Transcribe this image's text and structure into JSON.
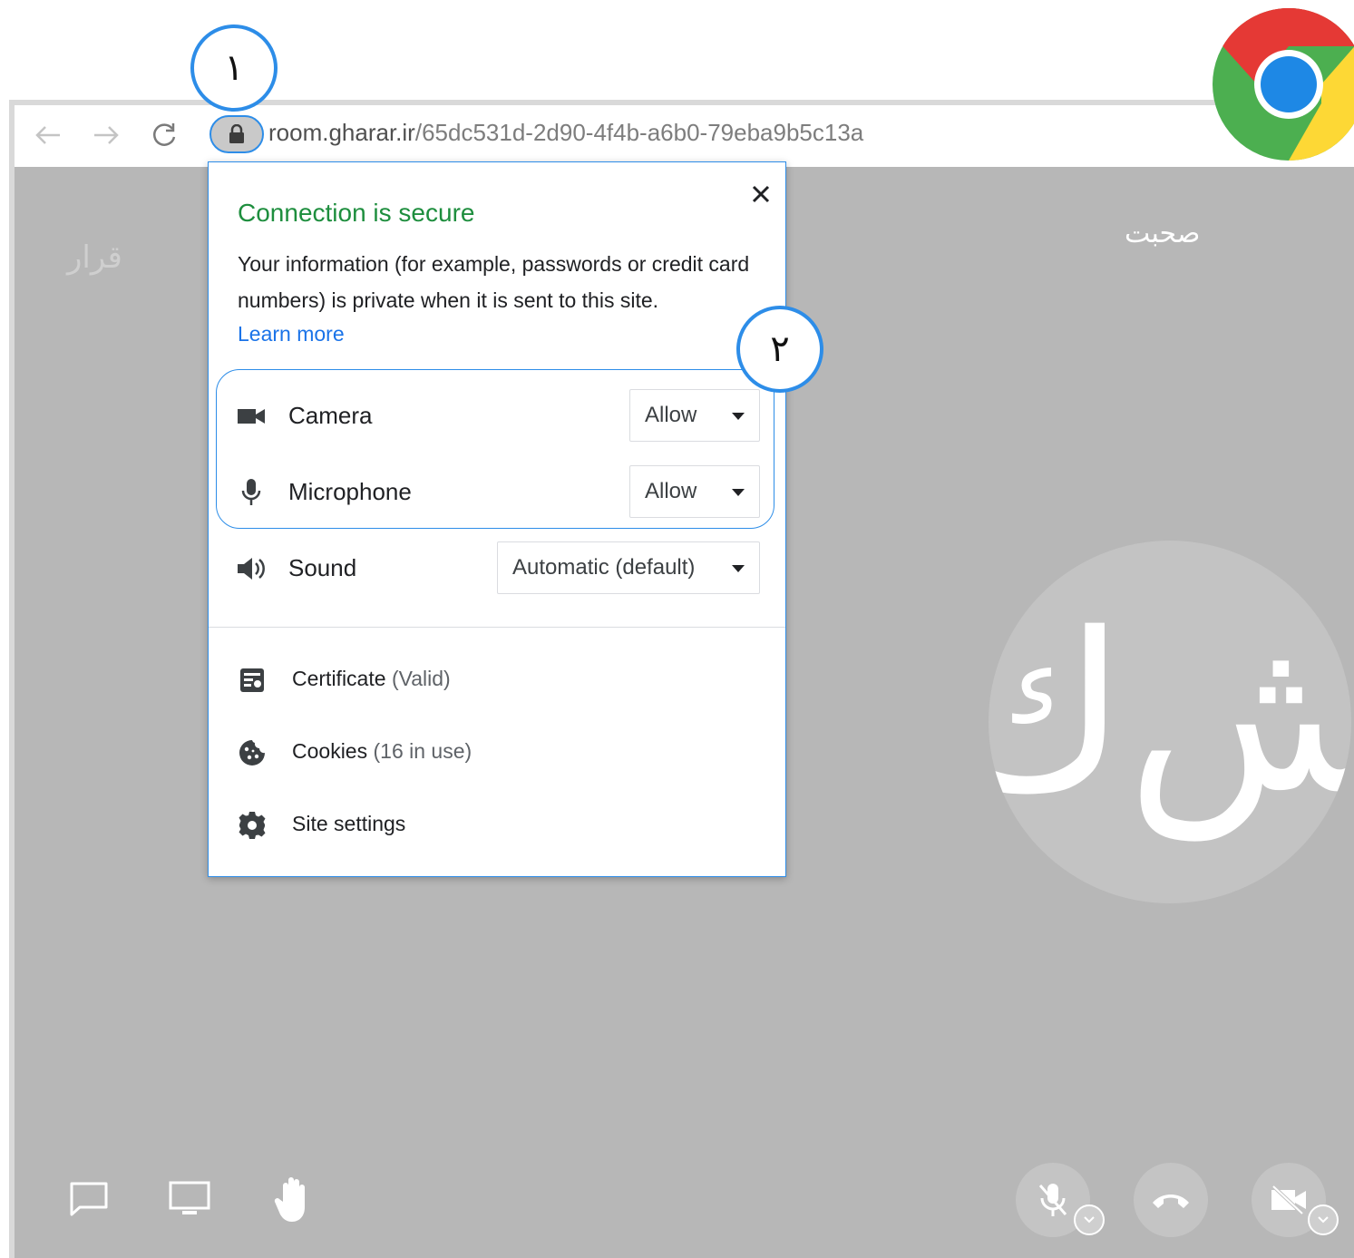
{
  "browser": {
    "url_host": "room.gharar.ir",
    "url_path": "/65dc531d-2d90-4f4b-a6b0-79eba9b5c13a"
  },
  "annotations": {
    "step1": "١",
    "step2": "٢"
  },
  "app": {
    "logo_text": "قرار",
    "chat_title": "صحبت",
    "avatar_initials": "ش‌ك"
  },
  "popup": {
    "title": "Connection is secure",
    "description": "Your information (for example, passwords or credit card numbers) is private when it is sent to this site.",
    "learn_more": "Learn more",
    "permissions": [
      {
        "label": "Camera",
        "value": "Allow",
        "icon": "camera-icon"
      },
      {
        "label": "Microphone",
        "value": "Allow",
        "icon": "microphone-icon"
      },
      {
        "label": "Sound",
        "value": "Automatic (default)",
        "icon": "speaker-icon"
      }
    ],
    "links": [
      {
        "label": "Certificate",
        "sub": "(Valid)",
        "icon": "certificate-icon"
      },
      {
        "label": "Cookies",
        "sub": "(16 in use)",
        "icon": "cookie-icon"
      },
      {
        "label": "Site settings",
        "sub": "",
        "icon": "gear-icon"
      }
    ]
  },
  "colors": {
    "accent_blue": "#2d8de8",
    "secure_green": "#1e8e3e",
    "link_blue": "#1a73e8",
    "app_background": "#b7b7b7"
  }
}
